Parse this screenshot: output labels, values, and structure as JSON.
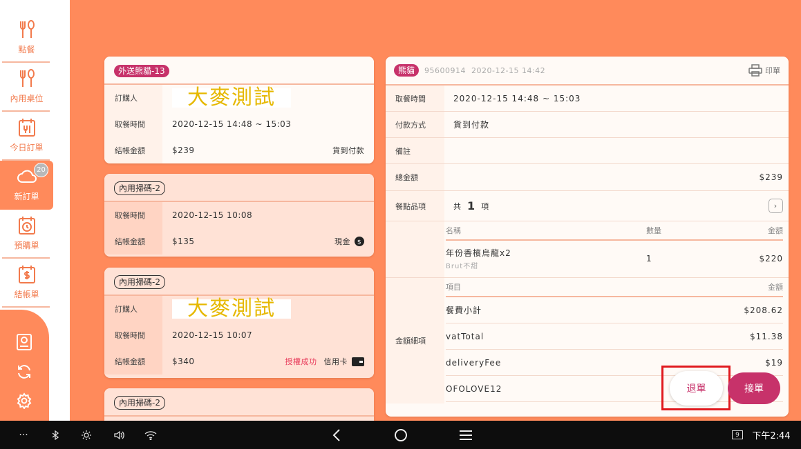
{
  "sidebar": {
    "items": [
      {
        "label": "點餐",
        "icon": "fork-knife-icon"
      },
      {
        "label": "內用桌位",
        "icon": "fork-knife-icon"
      },
      {
        "label": "今日訂單",
        "icon": "calendar-fork-icon"
      },
      {
        "label": "新訂單",
        "icon": "cloud-icon",
        "badge": "20"
      },
      {
        "label": "預購單",
        "icon": "calendar-clock-icon"
      },
      {
        "label": "結帳單",
        "icon": "calendar-dollar-icon"
      }
    ],
    "bottom_icons": [
      "cash-drawer-icon",
      "refresh-icon",
      "gear-icon"
    ]
  },
  "orders": [
    {
      "tag": "外送熊貓-13",
      "rows": [
        {
          "label": "訂購人",
          "value": "大麥測試"
        },
        {
          "label": "取餐時間",
          "value": "2020-12-15 14:48 ~ 15:03"
        },
        {
          "label": "結帳金額",
          "value": "$239",
          "payment": "貨到付款"
        }
      ]
    },
    {
      "tag": "內用掃碼-2",
      "rows": [
        {
          "label": "取餐時間",
          "value": "2020-12-15 10:08"
        },
        {
          "label": "結帳金額",
          "value": "$135",
          "payment": "現金"
        }
      ]
    },
    {
      "tag": "內用掃碼-2",
      "rows": [
        {
          "label": "訂購人",
          "value": "大麥測試"
        },
        {
          "label": "取餐時間",
          "value": "2020-12-15 10:07"
        },
        {
          "label": "結帳金額",
          "value": "$340",
          "auth": "授權成功",
          "payment": "信用卡"
        }
      ]
    },
    {
      "tag": "內用掃碼-2"
    }
  ],
  "detail": {
    "tag": "熊貓",
    "order_no": "95600914",
    "created": "2020-12-15 14:42",
    "print_label": "印單",
    "pickup_label": "取餐時間",
    "pickup_value": "2020-12-15 14:48 ~ 15:03",
    "payment_label": "付款方式",
    "payment_value": "貨到付款",
    "note_label": "備註",
    "total_label": "總金額",
    "total_value": "$239",
    "items_label": "餐點品項",
    "items_prefix": "共",
    "items_count": "1",
    "items_suffix": "項",
    "items_table": {
      "headers": [
        "名稱",
        "數量",
        "金額"
      ],
      "rows": [
        {
          "name": "年份香檳烏龍x2",
          "note": "Brut不甜",
          "qty": "1",
          "amount": "$220"
        }
      ]
    },
    "breakdown_label": "金額細項",
    "breakdown_table": {
      "headers": [
        "項目",
        "金額"
      ],
      "rows": [
        {
          "item": "餐費小計",
          "amount": "$208.62"
        },
        {
          "item": "vatTotal",
          "amount": "$11.38"
        },
        {
          "item": "deliveryFee",
          "amount": "$19"
        },
        {
          "item": "OFOLOVE12",
          "amount": ""
        }
      ]
    },
    "refund_button": "退單",
    "accept_button": "接單"
  },
  "system_bar": {
    "clock": "下午2:44",
    "notification_count": "9"
  },
  "colors": {
    "primary_orange": "#ff8a5b",
    "accent_magenta": "#c7326a",
    "highlight_red": "#e0191e"
  }
}
